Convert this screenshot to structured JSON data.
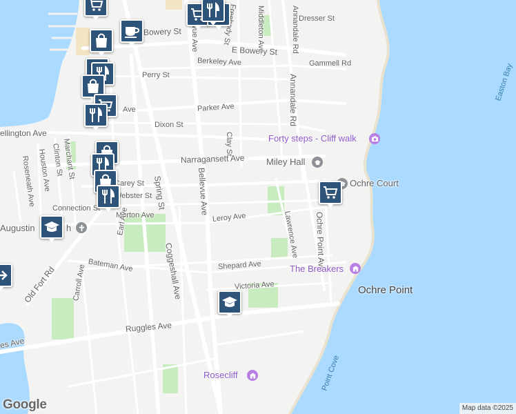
{
  "map": {
    "colors": {
      "water": "#aadaff",
      "land": "#f3f3f1",
      "park": "#c8ebc0",
      "road": "#ffffff",
      "pin": "#2f547a",
      "poi_purple": "#8e57c9",
      "poi_grey": "#5f6368"
    },
    "streets": {
      "bowery": "Bowery St",
      "e_bowery": "E Bowery St",
      "berkeley": "Berkeley Ave",
      "gammell": "Gammell Rd",
      "dresser": "Dresser St",
      "middleton": "Middleton Ave",
      "annandale_top": "Annandale Rd",
      "annandale": "Annandale Rd",
      "freebody": "Freebody St",
      "bellevue_top": "Bellevue Ave",
      "bellevue": "Bellevue Ave",
      "perry": "Perry St",
      "ave_frag": "Ave",
      "parker": "Parker Ave",
      "dixon": "Dixon St",
      "clay": "Clay St",
      "wellington": "ellington Ave",
      "narragansett": "Narragansett Ave",
      "roseneath": "Roseneath Ave",
      "houston": "Houston Ave",
      "clinton": "Clinton St",
      "marchant": "Marchant St",
      "spring": "Spring St",
      "carey": "Carey St",
      "webster": "Webster St",
      "connection": "Connection St",
      "morton": "Morton Ave",
      "leroy": "Leroy Ave",
      "lawrence": "Lawrence Ave",
      "ochre_point": "Ochre Point Ave",
      "earl": "Earl Ave",
      "coggeshall": "Coggeshall Ave",
      "bateman": "Bateman Ave",
      "shepard": "Shepard Ave",
      "victoria": "Victoria Ave",
      "old_fort": "Old Fort Rd",
      "carroll": "Carroll Ave",
      "ruggles": "Ruggles Ave",
      "es_ave": "es Ave",
      "point_cove": "Point Cove",
      "easton": "Easton Bay"
    },
    "places": {
      "forty_steps": "Forty steps - Cliff walk",
      "miley_hall": "Miley Hall",
      "ochre_court": "Ochre Court",
      "the_breakers": "The Breakers",
      "ochre_point": "Ochre Point",
      "rosecliff": "Rosecliff",
      "augustin": "Augustin",
      "augustin_ch": "h"
    },
    "markers": [
      {
        "icon": "shopping-cart"
      },
      {
        "icon": "shopping-cart"
      },
      {
        "icon": "fork-knife"
      },
      {
        "icon": "fork-knife"
      },
      {
        "icon": "coffee-cup"
      },
      {
        "icon": "shopping-bag"
      },
      {
        "icon": "shopping-bag"
      },
      {
        "icon": "fork-knife"
      },
      {
        "icon": "shopping-bag"
      },
      {
        "icon": "shopping-cart"
      },
      {
        "icon": "fork-knife"
      },
      {
        "icon": "shopping-bag"
      },
      {
        "icon": "fork-knife"
      },
      {
        "icon": "shopping-bag"
      },
      {
        "icon": "fork-knife"
      },
      {
        "icon": "graduation-cap"
      },
      {
        "icon": "arrow-right"
      },
      {
        "icon": "shopping-cart"
      },
      {
        "icon": "graduation-cap"
      }
    ],
    "logo": "Google",
    "attribution": "Map data ©2025"
  }
}
